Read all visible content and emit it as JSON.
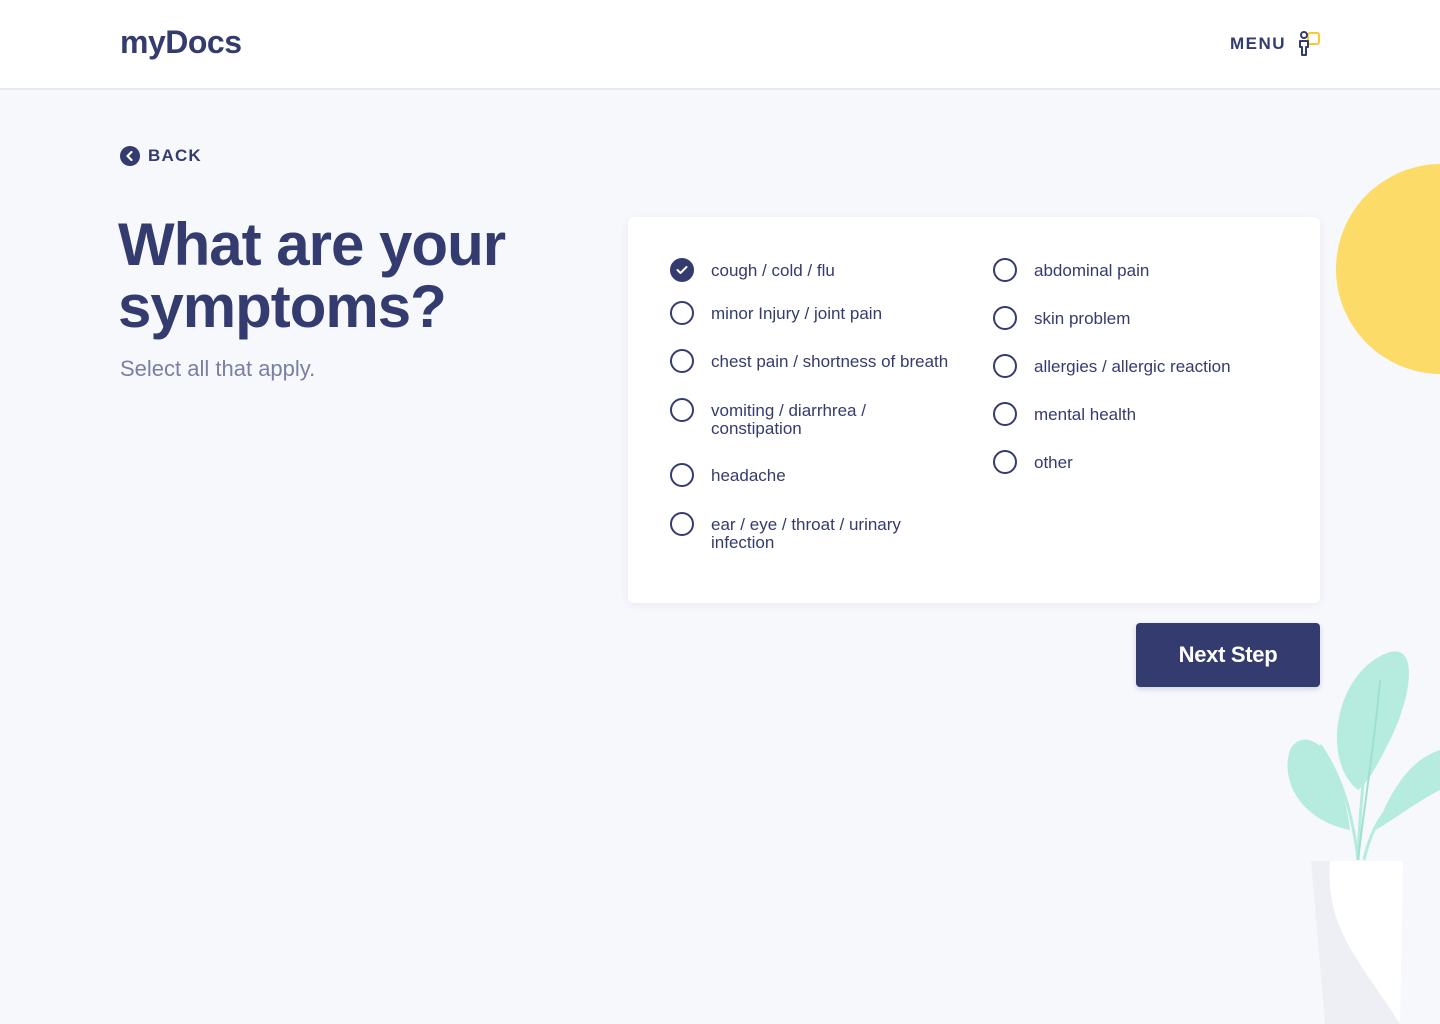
{
  "header": {
    "logo": "myDocs",
    "menu_label": "MENU"
  },
  "nav": {
    "back_label": "BACK"
  },
  "page": {
    "title": "What are your symptoms?",
    "subtitle": "Select all that apply."
  },
  "symptoms": {
    "left": [
      {
        "label": "cough / cold / flu",
        "checked": true
      },
      {
        "label": "minor Injury / joint pain",
        "checked": false
      },
      {
        "label": "chest pain / shortness of breath",
        "checked": false
      },
      {
        "label": "vomiting / diarrhrea / constipation",
        "checked": false
      },
      {
        "label": "headache",
        "checked": false
      },
      {
        "label": "ear / eye / throat / urinary infection",
        "checked": false
      }
    ],
    "right": [
      {
        "label": "abdominal pain",
        "checked": false
      },
      {
        "label": "skin problem",
        "checked": false
      },
      {
        "label": "allergies / allergic reaction",
        "checked": false
      },
      {
        "label": "mental health",
        "checked": false
      },
      {
        "label": "other",
        "checked": false
      }
    ]
  },
  "actions": {
    "next_label": "Next Step"
  },
  "colors": {
    "primary": "#343b6f",
    "background": "#f7f8fc",
    "accent_yellow": "#fddb68",
    "accent_mint": "#b6ecdf",
    "subtitle_gray": "#7a7fa3"
  },
  "icons": {
    "menu": "doctor-chat-icon",
    "back": "chevron-left-circle-icon",
    "checked": "check-icon"
  }
}
